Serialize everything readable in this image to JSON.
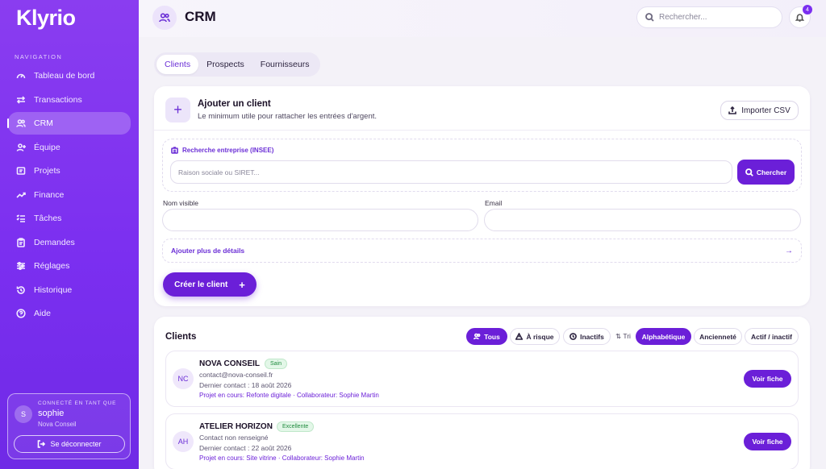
{
  "app": {
    "logo": "Klyrio"
  },
  "sidebar": {
    "nav_title": "NAVIGATION",
    "items": [
      {
        "label": "Tableau de bord",
        "icon": "dashboard-icon"
      },
      {
        "label": "Transactions",
        "icon": "transactions-icon"
      },
      {
        "label": "CRM",
        "icon": "users-icon",
        "active": true
      },
      {
        "label": "Équipe",
        "icon": "user-plus-icon"
      },
      {
        "label": "Projets",
        "icon": "folder-icon"
      },
      {
        "label": "Finance",
        "icon": "trend-icon"
      },
      {
        "label": "Tâches",
        "icon": "tasks-icon"
      },
      {
        "label": "Demandes",
        "icon": "clipboard-icon"
      },
      {
        "label": "Réglages",
        "icon": "settings-icon"
      },
      {
        "label": "Historique",
        "icon": "history-icon"
      },
      {
        "label": "Aide",
        "icon": "help-icon"
      }
    ],
    "user": {
      "caption": "CONNECTÉ EN TANT QUE",
      "initial": "S",
      "name": "sophie",
      "org": "Nova Conseil",
      "logout_label": "Se déconnecter"
    }
  },
  "header": {
    "title": "CRM",
    "search_placeholder": "Rechercher...",
    "notification_count": "4"
  },
  "tabs": [
    {
      "label": "Clients",
      "active": true
    },
    {
      "label": "Prospects"
    },
    {
      "label": "Fournisseurs"
    }
  ],
  "add_client": {
    "title": "Ajouter un client",
    "subtitle": "Le minimum utile pour rattacher les entrées d'argent.",
    "import_label": "Importer CSV",
    "insee_label": "Recherche entreprise (INSEE)",
    "insee_placeholder": "Raison sociale ou SIRET...",
    "search_button": "Chercher",
    "name_label": "Nom visible",
    "email_label": "Email",
    "more_details": "Ajouter plus de détails",
    "create_button": "Créer le client",
    "create_plus": "+"
  },
  "clients": {
    "title": "Clients",
    "filters": {
      "all": "Tous",
      "risk": "À risque",
      "inactive": "Inactifs"
    },
    "sort_label": "Tri",
    "sorts": {
      "alpha": "Alphabétique",
      "age": "Ancienneté",
      "active": "Actif / inactif"
    },
    "list": [
      {
        "initials": "NC",
        "name": "NOVA CONSEIL",
        "badge": "Sain",
        "contact": "contact@nova-conseil.fr",
        "last_contact": "Dernier contact : 18 août 2026",
        "project": "Projet en cours: Refonte digitale · Collaborateur: Sophie Martin",
        "button": "Voir fiche"
      },
      {
        "initials": "AH",
        "name": "ATELIER HORIZON",
        "badge": "Excellente",
        "contact": "Contact non renseigné",
        "last_contact": "Dernier contact : 22 août 2026",
        "project": "Projet en cours: Site vitrine · Collaborateur: Sophie Martin",
        "button": "Voir fiche"
      }
    ]
  }
}
